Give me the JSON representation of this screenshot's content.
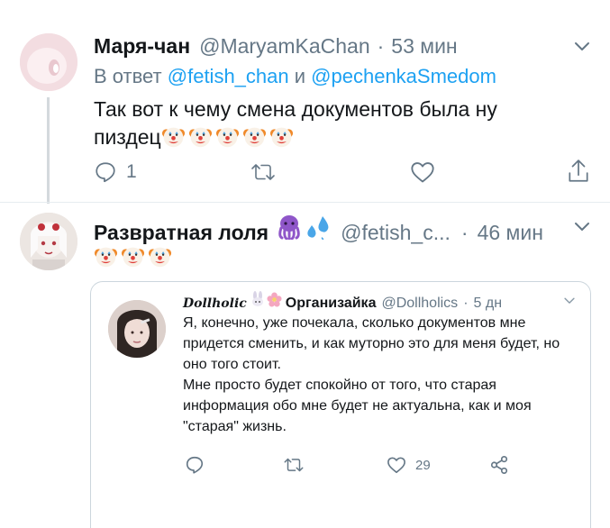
{
  "tweet1": {
    "name": "Маря-чан",
    "handle": "@MaryamKaChan",
    "separator": "·",
    "time": "53 мин",
    "reply_prefix": "В ответ",
    "reply_user1": "@fetish_chan",
    "reply_and": "и",
    "reply_user2": "@pechenkaSmedom",
    "text_line1": "Так вот к чему смена документов была ну",
    "text_line2": "пиздец",
    "reply_count": "1"
  },
  "tweet2": {
    "name": "Развратная лоля",
    "handle": "@fetish_c...",
    "separator": "·",
    "time": "46 мин"
  },
  "quote": {
    "brand": "Dollholic",
    "name": "Организайка",
    "handle": "@Dollholics",
    "separator": "·",
    "time": "5 дн",
    "text_p1": "Я, конечно, уже почекала, сколько документов мне придется сменить, и как муторно это для меня будет, но оно того стоит.",
    "text_p2": "Мне просто будет спокойно от того, что старая информация обо мне будет не актуальна, как и моя \"старая\" жизнь.",
    "like_count": "29"
  },
  "icons": {
    "reply": "reply-icon",
    "retweet": "retweet-icon",
    "like": "heart-icon",
    "share": "share-icon",
    "chevron": "chevron-down-icon"
  },
  "colors": {
    "link": "#1da1f2",
    "secondary_text": "#657786",
    "thread_line": "#d4d9dd",
    "border": "#ccd6dd"
  }
}
